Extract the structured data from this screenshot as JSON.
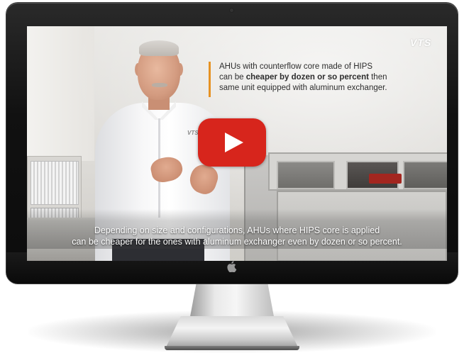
{
  "video": {
    "brand_logo": "VTS",
    "shirt_logo": "VTS",
    "caption": {
      "line1": "AHUs with counterflow core made of HIPS",
      "line2_prefix": "can be ",
      "line2_bold": "cheaper by dozen or so percent",
      "line2_suffix": " then",
      "line3": "same unit equipped with aluminum exchanger."
    },
    "subtitle": {
      "line1": "Depending on size and configurations, AHUs where HIPS core is applied",
      "line2": "can be cheaper for the ones with aluminum exchanger even by dozen or so percent."
    },
    "play_icon": "play-icon"
  },
  "colors": {
    "accent_orange": "#e69223",
    "play_red": "#d7251c",
    "bezel": "#111111"
  }
}
